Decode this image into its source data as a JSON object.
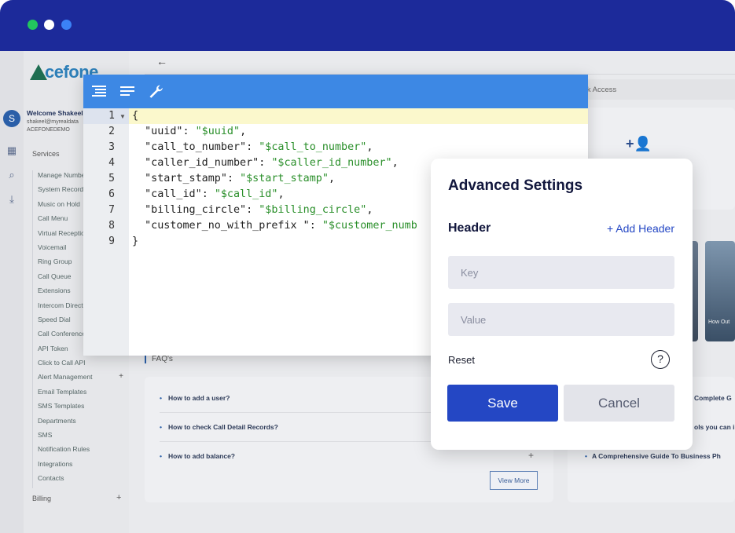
{
  "window": {
    "controls": [
      "green-dot",
      "white-dot",
      "blue-dot"
    ]
  },
  "app": {
    "logo_text": "cefone",
    "user": {
      "avatar_letter": "S",
      "welcome": "Welcome Shakeel",
      "email": "shakeel@myrealdata",
      "org": "ACEFONEDEMO"
    },
    "sidebar": {
      "services_label": "Services",
      "items": [
        {
          "label": "Manage Number"
        },
        {
          "label": "System Recordings"
        },
        {
          "label": "Music on Hold"
        },
        {
          "label": "Call Menu"
        },
        {
          "label": "Virtual Receptionist"
        },
        {
          "label": "Voicemail"
        },
        {
          "label": "Ring Group"
        },
        {
          "label": "Call Queue"
        },
        {
          "label": "Extensions"
        },
        {
          "label": "Intercom Directory"
        },
        {
          "label": "Speed Dial"
        },
        {
          "label": "Call Conference"
        },
        {
          "label": "API Token"
        },
        {
          "label": "Click to Call API"
        },
        {
          "label": "Alert Management"
        },
        {
          "label": "Email Templates"
        },
        {
          "label": "SMS Templates"
        },
        {
          "label": "Departments"
        },
        {
          "label": "SMS"
        },
        {
          "label": "Notification Rules"
        },
        {
          "label": "Integrations"
        },
        {
          "label": "Contacts"
        }
      ],
      "billing_label": "Billing",
      "plus": "+"
    },
    "quick_access": "ck Access",
    "faq": {
      "title": "FAQ's",
      "items": [
        "How to add a user?",
        "How to check Call Detail Records?",
        "How to add balance?"
      ],
      "plus": "+",
      "view_more": "View More"
    },
    "guides": {
      "items": [
        "Complete G",
        "ols you can i",
        "A Comprehensive Guide To Business Ph"
      ],
      "image_caption": "How Out"
    }
  },
  "editor": {
    "toolbar": [
      "format-icon",
      "compact-icon",
      "wrench-icon"
    ],
    "line_numbers": [
      "1",
      "2",
      "3",
      "4",
      "5",
      "6",
      "7",
      "8",
      "9"
    ],
    "lines": [
      {
        "key": "",
        "value": "{"
      },
      {
        "key": "\"uuid\"",
        "value": "\"$uuid\""
      },
      {
        "key": "\"call_to_number\"",
        "value": "\"$call_to_number\""
      },
      {
        "key": "\"caller_id_number\"",
        "value": "\"$caller_id_number\""
      },
      {
        "key": "\"start_stamp\"",
        "value": "\"$start_stamp\""
      },
      {
        "key": "\"call_id\"",
        "value": "\"$call_id\""
      },
      {
        "key": "\"billing_circle\"",
        "value": "\"$billing_circle\""
      },
      {
        "key": "\"customer_no_with_prefix \"",
        "value": "\"$customer_numb"
      },
      {
        "key": "",
        "value": "}"
      }
    ]
  },
  "modal": {
    "title": "Advanced Settings",
    "header_label": "Header",
    "add_header": "+ Add Header",
    "key_placeholder": "Key",
    "value_placeholder": "Value",
    "reset": "Reset",
    "help": "?",
    "save": "Save",
    "cancel": "Cancel"
  }
}
